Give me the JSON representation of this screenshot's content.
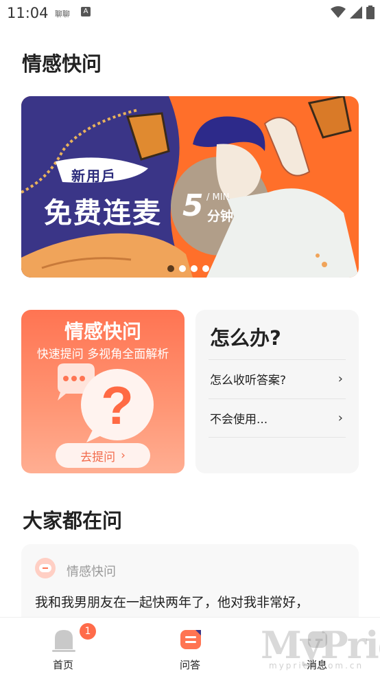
{
  "status_bar": {
    "time": "11:04",
    "indicator_text": "聊聊",
    "indicator_letter": "A"
  },
  "page": {
    "title": "情感快问"
  },
  "banner": {
    "badge": "新用戶",
    "headline": "免费连麦",
    "number": "5",
    "min_label": "/ MIN",
    "unit": "分钟",
    "colors": {
      "navy": "#3a3587",
      "orange": "#ff6f2a"
    },
    "slide_count": 4,
    "active_slide": 1
  },
  "feature_card": {
    "title": "情感快问",
    "subtitle": "快速提问 多视角全面解析",
    "button_label": "去提问",
    "button_chevron": "›",
    "accent": "#ff7452"
  },
  "help_card": {
    "title": "怎么办?",
    "items": [
      {
        "label": "怎么收听答案?",
        "chevron": "›"
      },
      {
        "label": "不会使用...",
        "chevron": "›"
      }
    ]
  },
  "section": {
    "title": "大家都在问"
  },
  "question": {
    "category": "情感快问",
    "text": "我和我男朋友在一起快两年了，他对我非常好，"
  },
  "bottom_nav": {
    "items": [
      {
        "label": "首页",
        "icon": "home-icon",
        "badge": "1"
      },
      {
        "label": "问答",
        "icon": "qa-icon"
      },
      {
        "label": "消息",
        "icon": "message-icon"
      }
    ],
    "active": "问答"
  },
  "watermark": {
    "text": "MyPrice",
    "sub": "myprice.com.cn"
  }
}
